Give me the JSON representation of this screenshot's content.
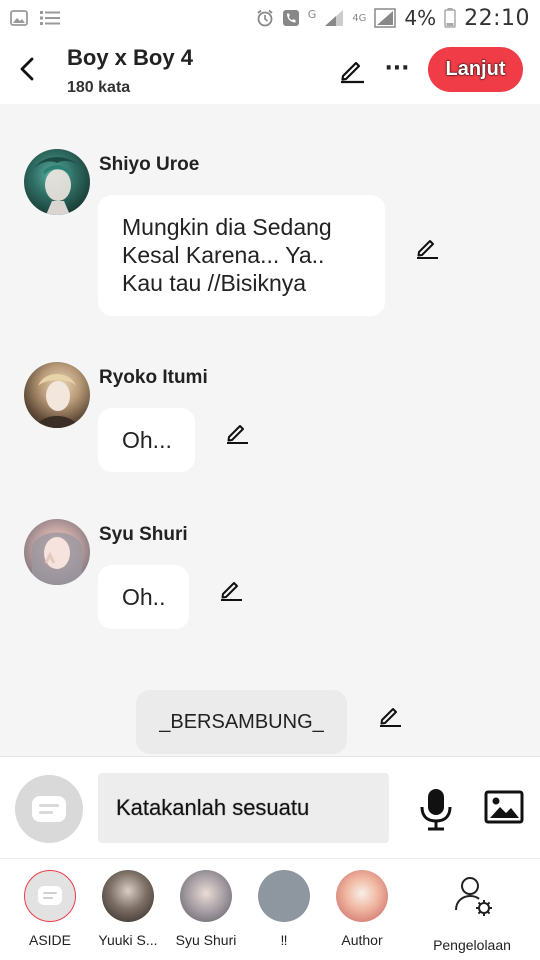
{
  "status_bar": {
    "network_label": "G",
    "network2_label": "4G",
    "battery_text": "4%",
    "time": "22:10"
  },
  "header": {
    "title": "Boy x Boy 4",
    "word_count": "180 kata",
    "next_label": "Lanjut",
    "icons": [
      "chevron-left-icon",
      "pencil-icon",
      "more-icon"
    ]
  },
  "messages": [
    {
      "sender": "Shiyo Uroe",
      "text": "Mungkin dia Sedang Kesal Karena... Ya.. Kau tau //Bisiknya"
    },
    {
      "sender": "Ryoko Itumi",
      "text": "Oh..."
    },
    {
      "sender": "Syu Shuri",
      "text": "Oh.."
    }
  ],
  "narration": {
    "text": "_BERSAMBUNG_"
  },
  "input": {
    "placeholder": "Katakanlah sesuatu"
  },
  "characters": [
    {
      "label": "ASIDE",
      "selected": true
    },
    {
      "label": "Yuuki S..."
    },
    {
      "label": "Syu Shuri"
    },
    {
      "label": "‼"
    },
    {
      "label": "Author"
    },
    {
      "label": "Pengelolaan"
    }
  ],
  "colors": {
    "accent": "#ef3c46",
    "background": "#f5f5f5",
    "bubble": "#ffffff"
  }
}
